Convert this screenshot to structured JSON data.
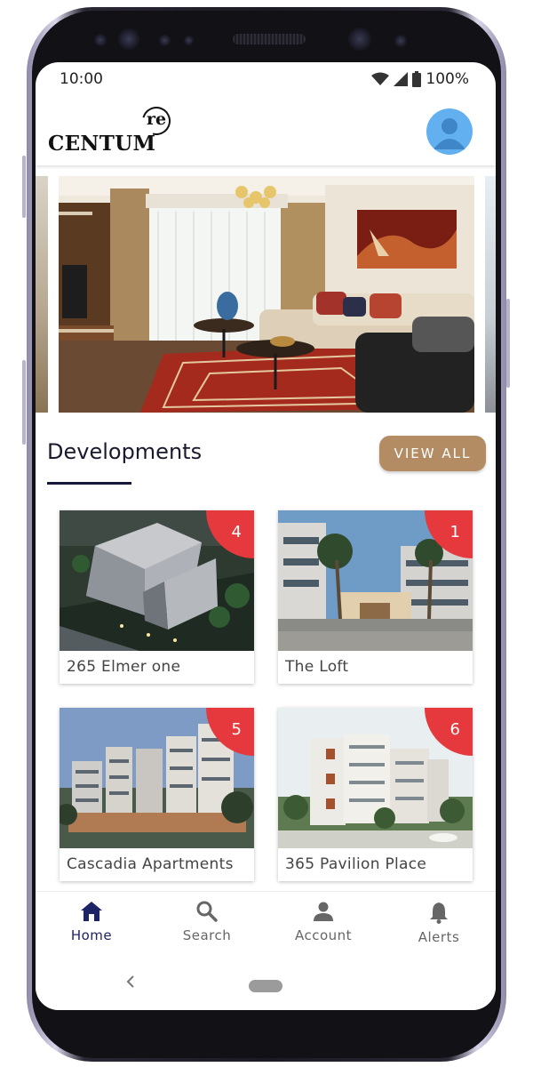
{
  "status_bar": {
    "time": "10:00",
    "battery": "100%"
  },
  "header": {
    "logo_text": "CENTUM",
    "logo_superscript": "re"
  },
  "hero": {
    "icon": "living-room-photo"
  },
  "developments": {
    "title": "Developments",
    "view_all_label": "VIEW ALL",
    "items": [
      {
        "name": "265 Elmer one",
        "count": "4"
      },
      {
        "name": "The Loft",
        "count": "1"
      },
      {
        "name": "Cascadia Apartments",
        "count": "5"
      },
      {
        "name": "365 Pavilion Place",
        "count": "6"
      }
    ]
  },
  "bottom_nav": {
    "items": [
      {
        "label": "Home",
        "icon": "home-icon",
        "active": true
      },
      {
        "label": "Search",
        "icon": "search-icon",
        "active": false
      },
      {
        "label": "Account",
        "icon": "account-icon",
        "active": false
      },
      {
        "label": "Alerts",
        "icon": "bell-icon",
        "active": false
      }
    ]
  },
  "colors": {
    "accent_gold": "#b48c64",
    "badge_red": "#e5393d",
    "nav_active": "#1d2466",
    "avatar_blue": "#62b0f0"
  }
}
